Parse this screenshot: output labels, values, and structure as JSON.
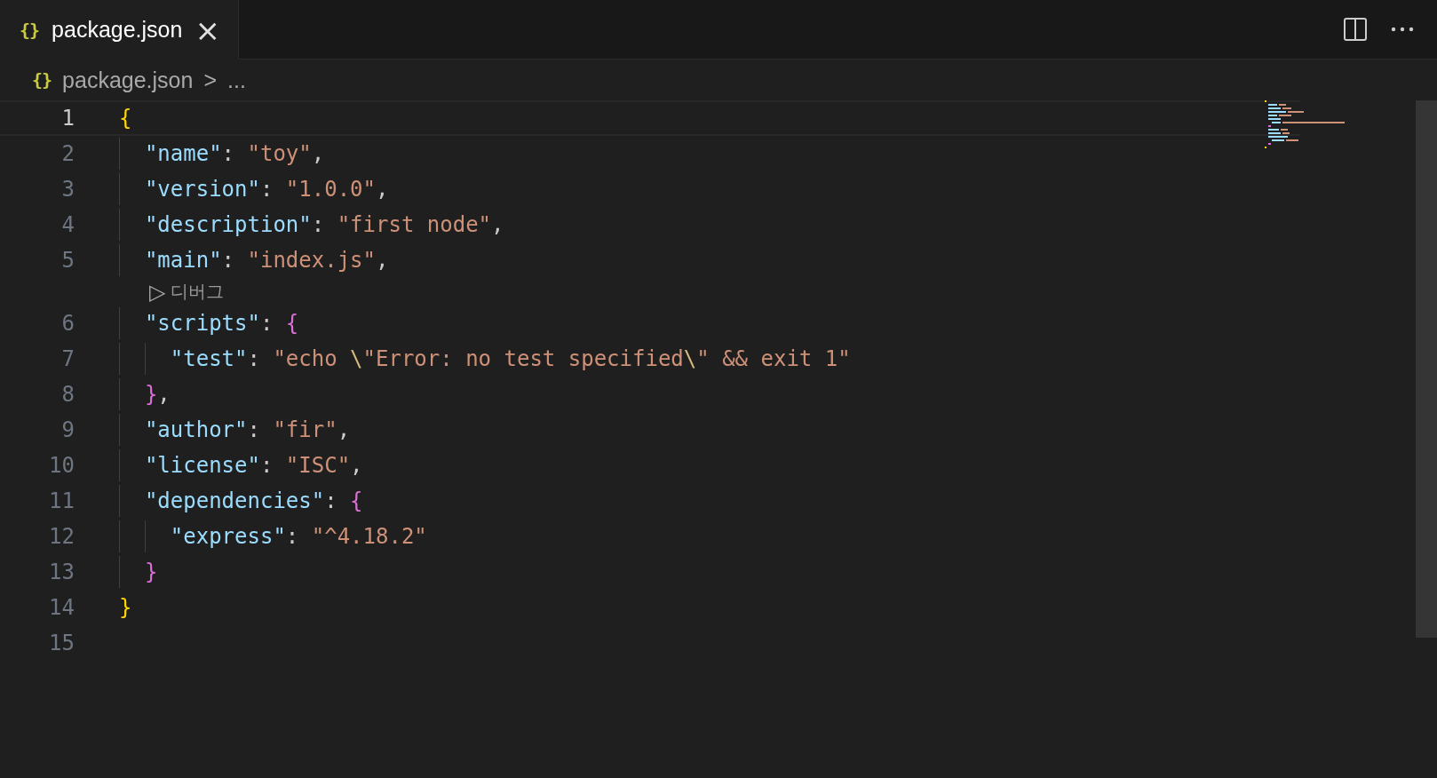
{
  "tab": {
    "title": "package.json",
    "icon": "{}",
    "selected": true,
    "close": "×"
  },
  "breadcrumb": {
    "icon": "{}",
    "file": "package.json",
    "separator": ">",
    "rest": "..."
  },
  "editor": {
    "lines": [
      {
        "number": "1",
        "current": true,
        "tokens": [
          {
            "kind": "bracket1",
            "text": "{"
          }
        ],
        "children": [
          {
            "number": "2",
            "current": false,
            "tokens": [
              {
                "kind": "key",
                "text": "\"name\""
              },
              {
                "kind": "punct",
                "text": ": "
              },
              {
                "kind": "string",
                "text": "\"toy\""
              },
              {
                "kind": "punct",
                "text": ","
              }
            ]
          },
          {
            "number": "3",
            "current": false,
            "tokens": [
              {
                "kind": "key",
                "text": "\"version\""
              },
              {
                "kind": "punct",
                "text": ": "
              },
              {
                "kind": "string",
                "text": "\"1.0.0\""
              },
              {
                "kind": "punct",
                "text": ","
              }
            ]
          },
          {
            "number": "4",
            "current": false,
            "tokens": [
              {
                "kind": "key",
                "text": "\"description\""
              },
              {
                "kind": "punct",
                "text": ": "
              },
              {
                "kind": "string",
                "text": "\"first node\""
              },
              {
                "kind": "punct",
                "text": ","
              }
            ]
          },
          {
            "number": "5",
            "current": false,
            "tokens": [
              {
                "kind": "key",
                "text": "\"main\""
              },
              {
                "kind": "punct",
                "text": ": "
              },
              {
                "kind": "string",
                "text": "\"index.js\""
              },
              {
                "kind": "punct",
                "text": ","
              }
            ],
            "codelens": {
              "icon": "▷",
              "label": "디버그"
            }
          },
          {
            "number": "6",
            "current": false,
            "tokens": [
              {
                "kind": "key",
                "text": "\"scripts\""
              },
              {
                "kind": "punct",
                "text": ": "
              },
              {
                "kind": "bracket2",
                "text": "{"
              }
            ],
            "children": [
              {
                "number": "7",
                "current": false,
                "tokens": [
                  {
                    "kind": "key",
                    "text": "\"test\""
                  },
                  {
                    "kind": "punct",
                    "text": ": "
                  },
                  {
                    "kind": "string",
                    "text": "\"echo "
                  },
                  {
                    "kind": "escape",
                    "text": "\\"
                  },
                  {
                    "kind": "string",
                    "text": "\"Error: no test specified"
                  },
                  {
                    "kind": "escape",
                    "text": "\\"
                  },
                  {
                    "kind": "string",
                    "text": "\" && exit 1\""
                  }
                ]
              }
            ]
          },
          {
            "number": "8",
            "current": false,
            "tokens": [
              {
                "kind": "bracket2",
                "text": "}"
              },
              {
                "kind": "punct",
                "text": ","
              }
            ]
          },
          {
            "number": "9",
            "current": false,
            "tokens": [
              {
                "kind": "key",
                "text": "\"author\""
              },
              {
                "kind": "punct",
                "text": ": "
              },
              {
                "kind": "string",
                "text": "\"fir\""
              },
              {
                "kind": "punct",
                "text": ","
              }
            ]
          },
          {
            "number": "10",
            "current": false,
            "tokens": [
              {
                "kind": "key",
                "text": "\"license\""
              },
              {
                "kind": "punct",
                "text": ": "
              },
              {
                "kind": "string",
                "text": "\"ISC\""
              },
              {
                "kind": "punct",
                "text": ","
              }
            ]
          },
          {
            "number": "11",
            "current": false,
            "tokens": [
              {
                "kind": "key",
                "text": "\"dependencies\""
              },
              {
                "kind": "punct",
                "text": ": "
              },
              {
                "kind": "bracket2",
                "text": "{"
              }
            ],
            "children": [
              {
                "number": "12",
                "current": false,
                "tokens": [
                  {
                    "kind": "key",
                    "text": "\"express\""
                  },
                  {
                    "kind": "punct",
                    "text": ": "
                  },
                  {
                    "kind": "string",
                    "text": "\"^4.18.2\""
                  }
                ]
              }
            ]
          },
          {
            "number": "13",
            "current": false,
            "tokens": [
              {
                "kind": "bracket2",
                "text": "}"
              }
            ]
          }
        ]
      },
      {
        "number": "14",
        "current": false,
        "tokens": [
          {
            "kind": "bracket1",
            "text": "}"
          }
        ]
      },
      {
        "number": "15",
        "current": false
      }
    ]
  }
}
